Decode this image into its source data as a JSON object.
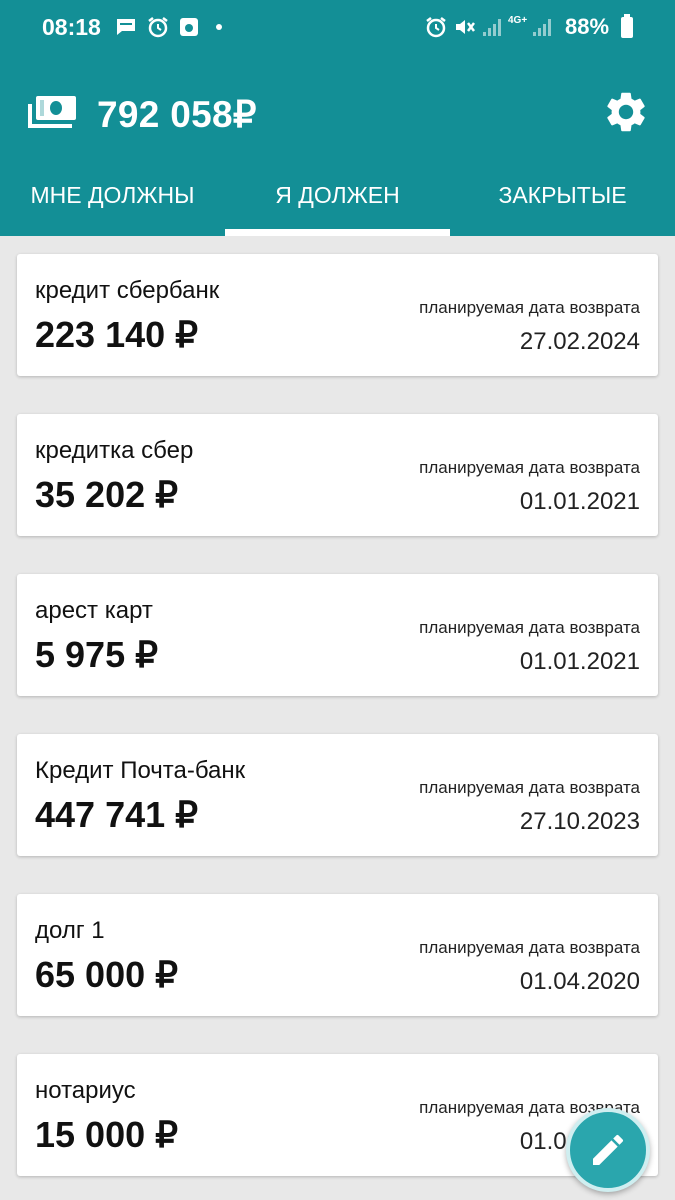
{
  "status_bar": {
    "time": "08:18",
    "network": "4G+",
    "battery": "88%"
  },
  "header": {
    "total": "792 058₽",
    "icons": [
      "money-stack-icon",
      "gear-icon"
    ]
  },
  "tabs": [
    {
      "label": "МНЕ ДОЛЖНЫ",
      "active": false
    },
    {
      "label": "Я ДОЛЖЕН",
      "active": true
    },
    {
      "label": "ЗАКРЫТЫЕ",
      "active": false
    }
  ],
  "debts": [
    {
      "name": "кредит сбербанк",
      "amount": "223 140 ₽",
      "date_label": "планируемая дата возврата",
      "date": "27.02.2024"
    },
    {
      "name": "кредитка сбер",
      "amount": "35 202 ₽",
      "date_label": "планируемая дата возврата",
      "date": "01.01.2021"
    },
    {
      "name": "арест карт",
      "amount": "5 975 ₽",
      "date_label": "планируемая дата возврата",
      "date": "01.01.2021"
    },
    {
      "name": "Кредит Почта-банк",
      "amount": "447 741 ₽",
      "date_label": "планируемая дата возврата",
      "date": "27.10.2023"
    },
    {
      "name": "долг 1",
      "amount": "65 000 ₽",
      "date_label": "планируемая дата возврата",
      "date": "01.04.2020"
    },
    {
      "name": "нотариус",
      "amount": "15 000 ₽",
      "date_label": "планируемая дата возврата",
      "date": "01.06.2021"
    }
  ],
  "colors": {
    "primary": "#138f96",
    "background": "#e8e8e8",
    "card": "#ffffff",
    "fab": "#2aa6ad"
  }
}
